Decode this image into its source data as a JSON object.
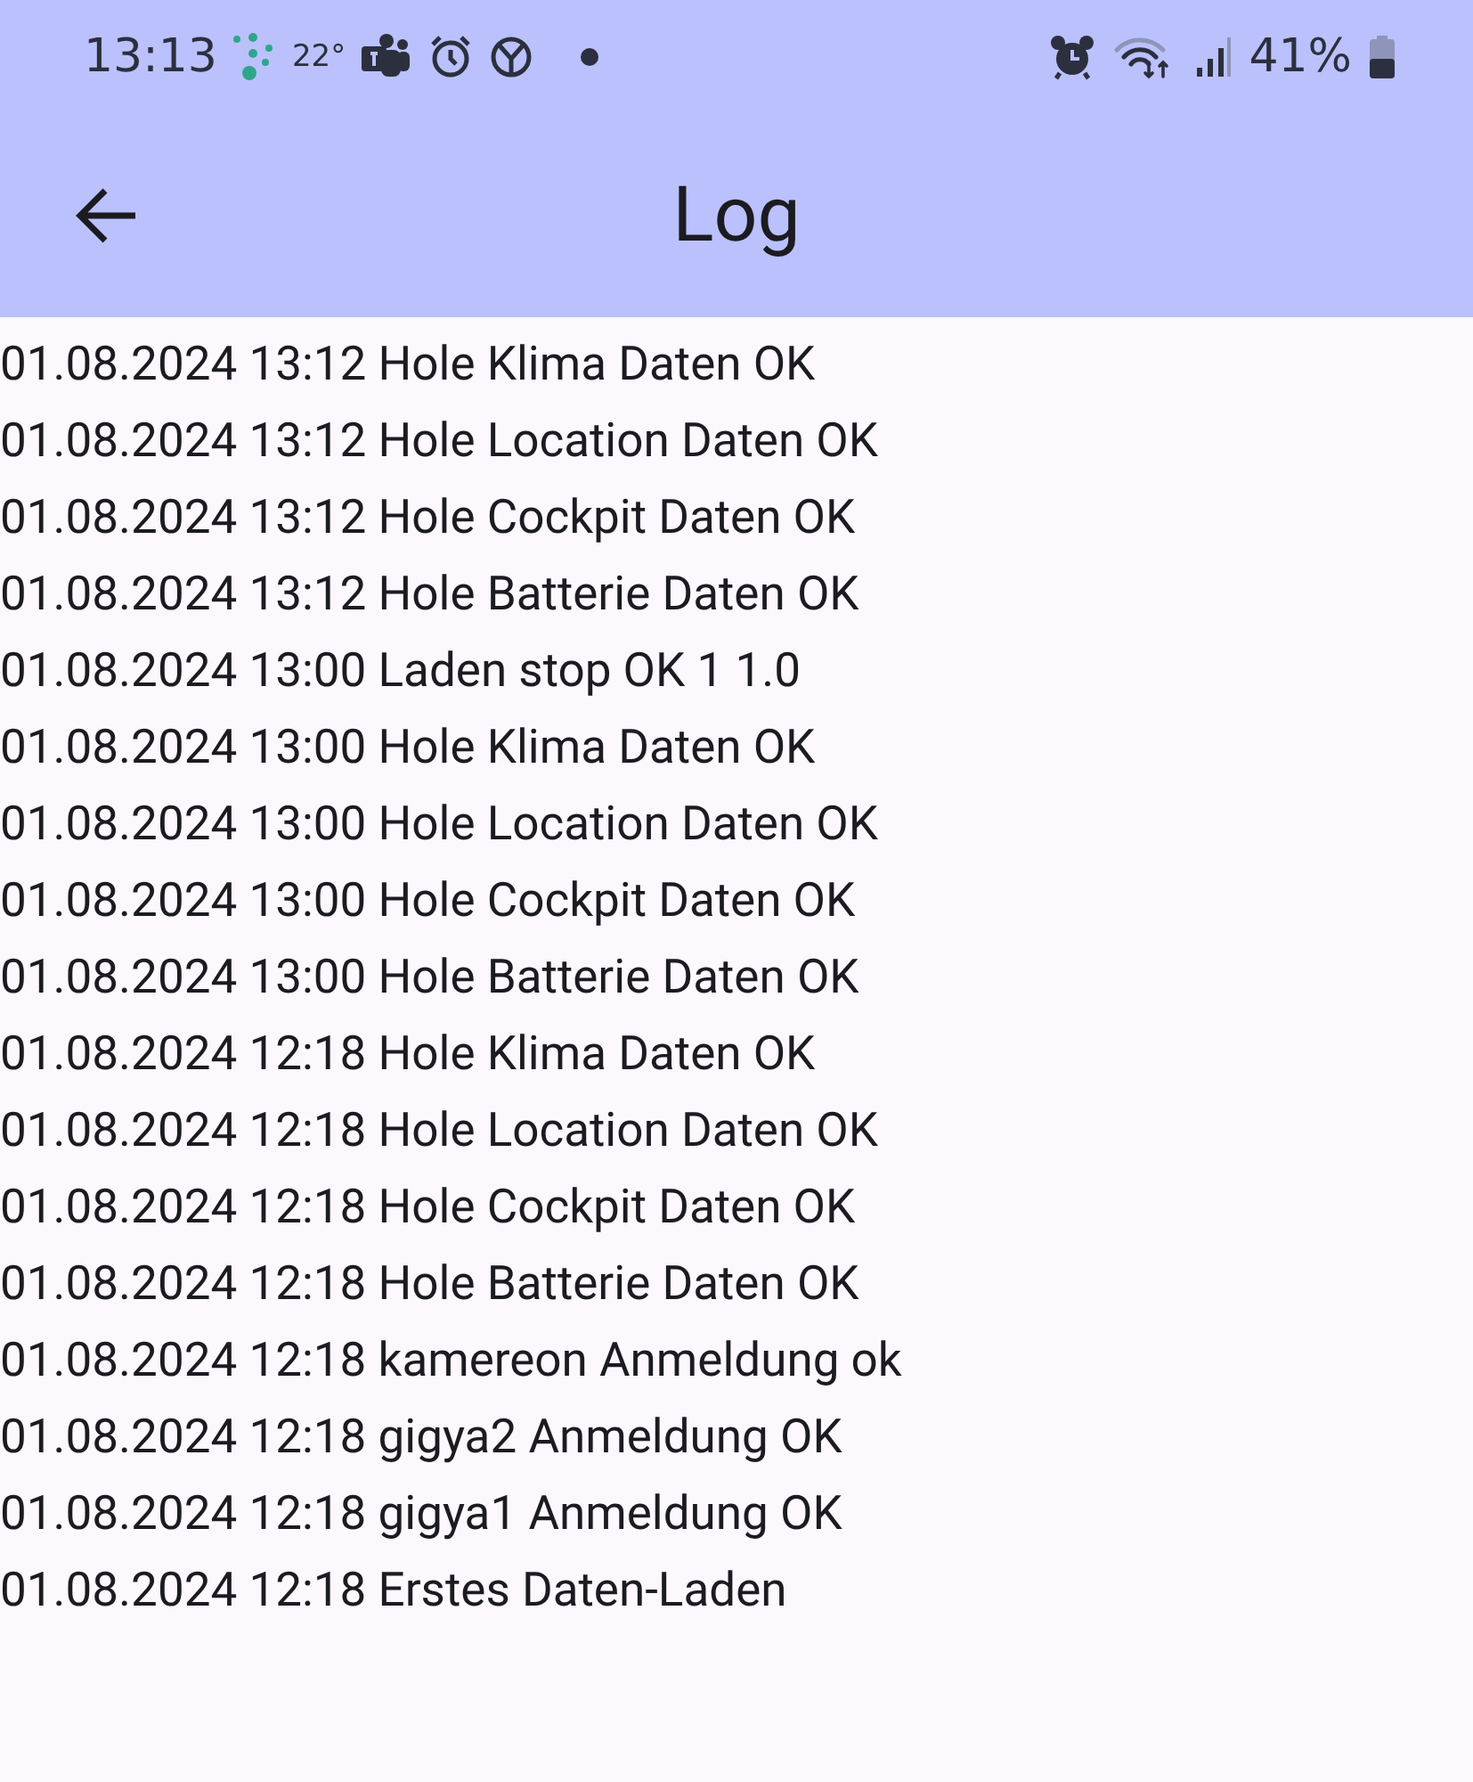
{
  "status_bar": {
    "time": "13:13",
    "temperature": "22°",
    "battery_percent": "41%"
  },
  "app_bar": {
    "title": "Log"
  },
  "log_entries": [
    "01.08.2024 13:12 Hole Klima Daten OK",
    "01.08.2024 13:12 Hole Location Daten OK",
    "01.08.2024 13:12 Hole Cockpit Daten OK",
    "01.08.2024 13:12 Hole Batterie Daten OK",
    "01.08.2024 13:00 Laden stop OK 1 1.0",
    "01.08.2024 13:00 Hole Klima Daten OK",
    "01.08.2024 13:00 Hole Location Daten OK",
    "01.08.2024 13:00 Hole Cockpit Daten OK",
    "01.08.2024 13:00 Hole Batterie Daten OK",
    "01.08.2024 12:18 Hole Klima Daten OK",
    "01.08.2024 12:18 Hole Location Daten OK",
    "01.08.2024 12:18 Hole Cockpit Daten OK",
    "01.08.2024 12:18 Hole Batterie Daten OK",
    "01.08.2024 12:18 kamereon Anmeldung ok",
    "01.08.2024 12:18 gigya2 Anmeldung OK",
    "01.08.2024 12:18 gigya1 Anmeldung OK",
    "01.08.2024 12:18 Erstes Daten-Laden"
  ]
}
